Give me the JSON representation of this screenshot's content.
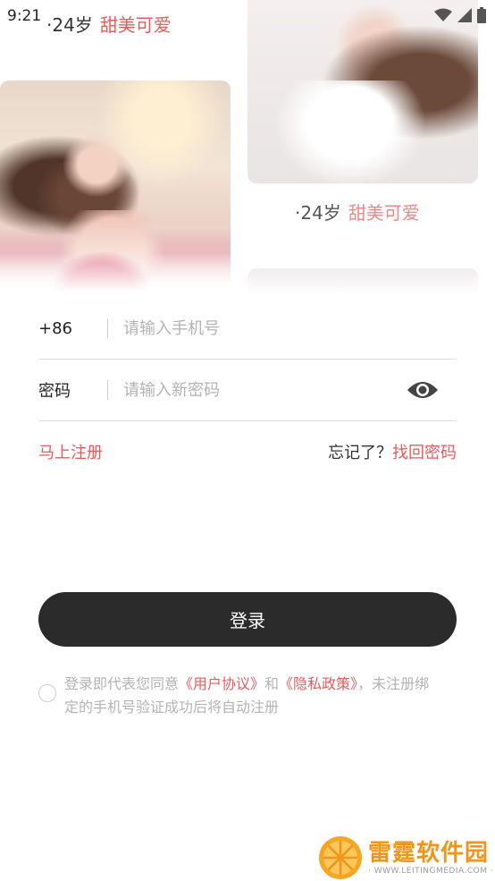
{
  "status": {
    "time": "9:21"
  },
  "cards": [
    {
      "age": "·24岁",
      "tag": "甜美可爱"
    },
    {
      "age": "·24岁",
      "tag": "甜美可爱"
    }
  ],
  "form": {
    "country_code": "+86",
    "phone_placeholder": "请输入手机号",
    "password_label": "密码",
    "password_placeholder": "请输入新密码"
  },
  "links": {
    "register": "马上注册",
    "forgot_prefix": "忘记了？",
    "forgot_link": "找回密码"
  },
  "login_button": "登录",
  "agreement": {
    "prefix": "登录即代表您同意",
    "user_agreement": "《用户协议》",
    "and": "和",
    "privacy_policy": "《隐私政策》",
    "suffix": "，未注册绑定的手机号验证成功后将自动注册"
  },
  "watermark": {
    "title": "雷霆软件园",
    "url": "· WWW.LEITINGMEDIA.COM ·"
  },
  "colors": {
    "accent": "#e95b5b",
    "button": "#2c2b2b"
  }
}
